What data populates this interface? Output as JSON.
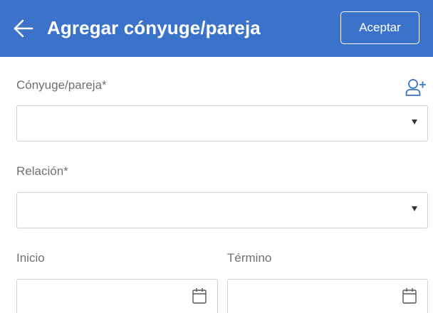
{
  "header": {
    "back_icon": "arrow-left-icon",
    "title": "Agregar cónyuge/pareja",
    "accept_label": "Aceptar",
    "background_color": "#3a73c9"
  },
  "form": {
    "spouse": {
      "label": "Cónyuge/pareja*",
      "value": "",
      "add_icon": "add-person-icon",
      "icon_color": "#3a73c9"
    },
    "relation": {
      "label": "Relación*",
      "value": ""
    },
    "start": {
      "label": "Inicio",
      "value": "",
      "icon": "calendar-icon"
    },
    "end": {
      "label": "Término",
      "value": "",
      "icon": "calendar-icon"
    }
  }
}
